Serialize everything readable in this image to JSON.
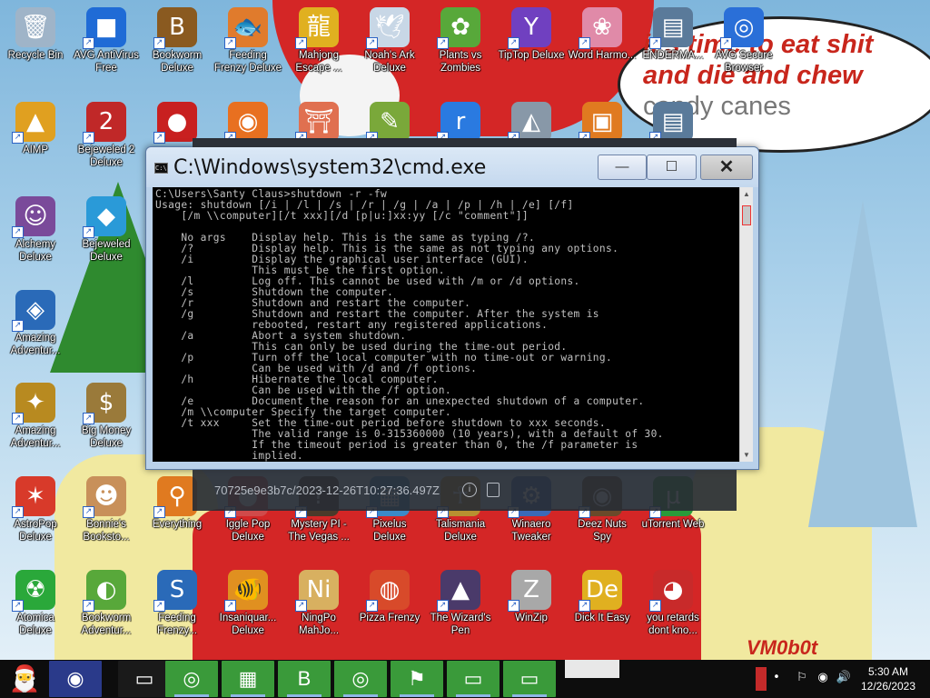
{
  "wallpaper": {
    "bubble_line1": "it's time to eat shit",
    "bubble_line2": "and die and chew",
    "bubble_line3": "candy canes",
    "signature": "VM0b0t"
  },
  "desktop_icons": [
    {
      "label": "Recycle Bin",
      "icon": "recycle-bin-icon",
      "glyph": "🗑",
      "color": "#9fb4c8"
    },
    {
      "label": "AVG AntiVirus Free",
      "icon": "avg-antivirus-icon",
      "glyph": "■",
      "color": "#1f6bd6"
    },
    {
      "label": "Bookworm Deluxe",
      "icon": "bookworm-icon",
      "glyph": "B",
      "color": "#8a5a20"
    },
    {
      "label": "Feeding Frenzy Deluxe",
      "icon": "feeding-frenzy-icon",
      "glyph": "🐟",
      "color": "#e07b2c"
    },
    {
      "label": "Mahjong Escape ...",
      "icon": "mahjong-escape-icon",
      "glyph": "龍",
      "color": "#e0b020"
    },
    {
      "label": "Noah's Ark Deluxe",
      "icon": "noahs-ark-icon",
      "glyph": "🕊",
      "color": "#c8d7e6"
    },
    {
      "label": "Plants vs Zombies",
      "icon": "plants-vs-zombies-icon",
      "glyph": "✿",
      "color": "#58a83a"
    },
    {
      "label": "TipTop Deluxe",
      "icon": "tiptop-icon",
      "glyph": "Y",
      "color": "#7040c0"
    },
    {
      "label": "Word Harmo...",
      "icon": "word-harmony-icon",
      "glyph": "❀",
      "color": "#e08aa8"
    },
    {
      "label": "ENDERMA...",
      "icon": "enderman-icon",
      "glyph": "▤",
      "color": "#5a7a9a"
    },
    {
      "label": "AVG Secure Browser",
      "icon": "avg-browser-icon",
      "glyph": "◎",
      "color": "#2a6fd8"
    },
    {
      "label": "AIMP",
      "icon": "aimp-icon",
      "glyph": "▲",
      "color": "#e0a020"
    },
    {
      "label": "Bejeweled 2 Deluxe",
      "icon": "bejeweled2-icon",
      "glyph": "2",
      "color": "#c02828"
    },
    {
      "label": "Alchemy Deluxe",
      "icon": "alchemy-icon",
      "glyph": "☺",
      "color": "#7a4a9a"
    },
    {
      "label": "Bejeweled Deluxe",
      "icon": "bejeweled-icon",
      "glyph": "◆",
      "color": "#2a9ad8"
    },
    {
      "label": "Amazing Adventur...",
      "icon": "amazing-adventures-icon",
      "glyph": "◈",
      "color": "#2a6ab8"
    },
    {
      "label": "Amazing Adventur...",
      "icon": "amazing-adventures-2-icon",
      "glyph": "✦",
      "color": "#b88a20"
    },
    {
      "label": "Big Money Deluxe",
      "icon": "big-money-icon",
      "glyph": "$",
      "color": "#9a7a3a"
    },
    {
      "label": "AstroPop Deluxe",
      "icon": "astropop-icon",
      "glyph": "✶",
      "color": "#d83a2a"
    },
    {
      "label": "Bonnie's Booksto...",
      "icon": "bonnies-bookstore-icon",
      "glyph": "☻",
      "color": "#c8905a"
    },
    {
      "label": "Everything",
      "icon": "everything-icon",
      "glyph": "⚲",
      "color": "#e07a20"
    },
    {
      "label": "Iggle Pop Deluxe",
      "icon": "iggle-pop-icon",
      "glyph": "●",
      "color": "#d04a4a"
    },
    {
      "label": "Mystery PI - The Vegas ...",
      "icon": "mystery-pi-icon",
      "glyph": "?",
      "color": "#4a3a2a"
    },
    {
      "label": "Pixelus Deluxe",
      "icon": "pixelus-icon",
      "glyph": "▦",
      "color": "#3a8ac8"
    },
    {
      "label": "Talismania Deluxe",
      "icon": "talismania-icon",
      "glyph": "☥",
      "color": "#b89030"
    },
    {
      "label": "Winaero Tweaker",
      "icon": "winaero-tweaker-icon",
      "glyph": "⚙",
      "color": "#3a6ab8"
    },
    {
      "label": "Deez Nuts Spy",
      "icon": "deez-nuts-icon",
      "glyph": "◉",
      "color": "#6a4a2a"
    },
    {
      "label": "uTorrent Web",
      "icon": "utorrent-icon",
      "glyph": "µ",
      "color": "#2a9a3a"
    },
    {
      "label": "Atomica Deluxe",
      "icon": "atomica-icon",
      "glyph": "☢",
      "color": "#2aa83a"
    },
    {
      "label": "Bookworm Adventur...",
      "icon": "bookworm-adventures-icon",
      "glyph": "◐",
      "color": "#58a83a"
    },
    {
      "label": "Feeding Frenzy...",
      "icon": "feeding-frenzy-2-icon",
      "glyph": "S",
      "color": "#2a6ab8"
    },
    {
      "label": "Insaniquar... Deluxe",
      "icon": "insaniquarium-icon",
      "glyph": "🐠",
      "color": "#e09020"
    },
    {
      "label": "NingPo MahJo...",
      "icon": "ningpo-mahjong-icon",
      "glyph": "Ni",
      "color": "#d8b060"
    },
    {
      "label": "Pizza Frenzy",
      "icon": "pizza-frenzy-icon",
      "glyph": "◍",
      "color": "#d84a2a"
    },
    {
      "label": "The Wizard's Pen",
      "icon": "wizards-pen-icon",
      "glyph": "▲",
      "color": "#4a3a6a"
    },
    {
      "label": "WinZip",
      "icon": "winzip-icon",
      "glyph": "Z",
      "color": "#a8a8a8"
    },
    {
      "label": "Dick It Easy",
      "icon": "dick-it-easy-icon",
      "glyph": "De",
      "color": "#e0b020"
    },
    {
      "label": "you retards dont kno...",
      "icon": "you-retards-icon",
      "glyph": "◕",
      "color": "#c82a2a"
    },
    {
      "label": "",
      "icon": "red-creature-icon",
      "glyph": "●",
      "color": "#c82020"
    },
    {
      "label": "",
      "icon": "firefox-desktop-icon",
      "glyph": "◉",
      "color": "#e87020"
    },
    {
      "label": "",
      "icon": "torii-icon",
      "glyph": "⛩",
      "color": "#e07050"
    },
    {
      "label": "",
      "icon": "frog-notepad-icon",
      "glyph": "✎",
      "color": "#7aa83a"
    },
    {
      "label": "",
      "icon": "blue-r-icon",
      "glyph": "r",
      "color": "#2a7ae0"
    },
    {
      "label": "",
      "icon": "shark-icon",
      "glyph": "◭",
      "color": "#8898a8"
    },
    {
      "label": "",
      "icon": "orange-blocks-icon",
      "glyph": "▣",
      "color": "#e07a20"
    },
    {
      "label": "",
      "icon": "window-screenshot-icon",
      "glyph": "▤",
      "color": "#5a7a9a"
    }
  ],
  "cmd": {
    "title": "C:\\Windows\\system32\\cmd.exe",
    "minimize": "—",
    "maximize": "☐",
    "close": "✕",
    "output": "C:\\Users\\Santy Claus>shutdown -r -fw\nUsage: shutdown [/i | /l | /s | /r | /g | /a | /p | /h | /e] [/f]\n    [/m \\\\computer][/t xxx][/d [p|u:]xx:yy [/c \"comment\"]]\n\n    No args    Display help. This is the same as typing /?.\n    /?         Display help. This is the same as not typing any options.\n    /i         Display the graphical user interface (GUI).\n               This must be the first option.\n    /l         Log off. This cannot be used with /m or /d options.\n    /s         Shutdown the computer.\n    /r         Shutdown and restart the computer.\n    /g         Shutdown and restart the computer. After the system is\n               rebooted, restart any registered applications.\n    /a         Abort a system shutdown.\n               This can only be used during the time-out period.\n    /p         Turn off the local computer with no time-out or warning.\n               Can be used with /d and /f options.\n    /h         Hibernate the local computer.\n               Can be used with the /f option.\n    /e         Document the reason for an unexpected shutdown of a computer.\n    /m \\\\computer Specify the target computer.\n    /t xxx     Set the time-out period before shutdown to xxx seconds.\n               The valid range is 0-315360000 (10 years), with a default of 30.\n               If the timeout period is greater than 0, the /f parameter is\n               implied."
  },
  "overlay": {
    "id_text": "70725e9e3b7c/2023-12-26T10:27:36.497Z",
    "info": "i"
  },
  "taskbar": {
    "items": [
      {
        "icon": "santa-start-icon",
        "glyph": "🎅"
      },
      {
        "icon": "firefox-icon",
        "glyph": "◉",
        "color": "#2a3a8a"
      },
      {
        "icon": "file-explorer-icon",
        "glyph": "▭",
        "color": "#1a1a1a"
      },
      {
        "icon": "chrome-icon",
        "glyph": "◎",
        "color": "#3a9a3a"
      },
      {
        "icon": "control-panel-icon",
        "glyph": "▦",
        "color": "#3a9a3a"
      },
      {
        "icon": "bookworm-taskbar-icon",
        "glyph": "B",
        "color": "#3a9a3a"
      },
      {
        "icon": "avg-browser-taskbar-icon",
        "glyph": "◎",
        "color": "#3a9a3a"
      },
      {
        "icon": "windows-flag-icon",
        "glyph": "⚑",
        "color": "#3a9a3a"
      },
      {
        "icon": "computer-icon",
        "glyph": "▭",
        "color": "#3a9a3a"
      },
      {
        "icon": "cmd-taskbar-icon",
        "glyph": "▭",
        "color": "#3a9a3a"
      }
    ],
    "time": "5:30 AM",
    "date": "12/26/2023"
  }
}
